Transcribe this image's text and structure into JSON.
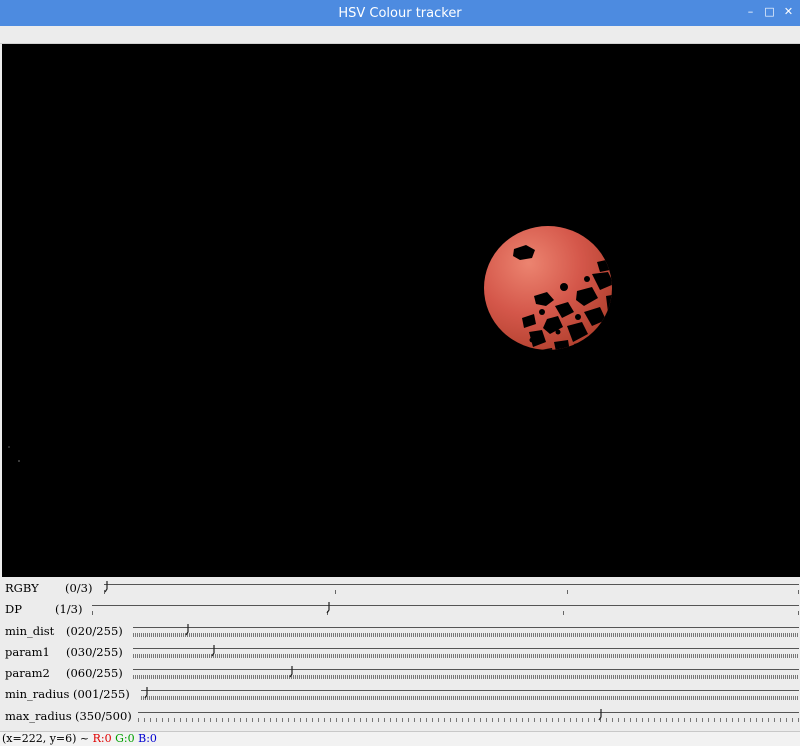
{
  "window": {
    "title": "HSV Colour tracker",
    "controls": [
      "minimize-icon",
      "maximize-icon",
      "close-icon"
    ]
  },
  "trackbars": [
    {
      "label": "RGBY",
      "value_text": "(0/3)",
      "value": 0,
      "max": 3,
      "tick_style": "sparse"
    },
    {
      "label": "DP",
      "value_text": "(1/3)",
      "value": 1,
      "max": 3,
      "tick_style": "sparse"
    },
    {
      "label": "min_dist",
      "value_text": "(020/255)",
      "value": 20,
      "max": 255,
      "tick_style": "dense"
    },
    {
      "label": "param1",
      "value_text": "(030/255)",
      "value": 30,
      "max": 255,
      "tick_style": "dense"
    },
    {
      "label": "param2",
      "value_text": "(060/255)",
      "value": 60,
      "max": 255,
      "tick_style": "dense"
    },
    {
      "label": "min_radius",
      "value_text": "(001/255)",
      "value": 1,
      "max": 255,
      "tick_style": "dense"
    },
    {
      "label": "max_radius",
      "value_text": "(350/500)",
      "value": 350,
      "max": 500,
      "tick_style": "medium"
    }
  ],
  "status": {
    "coords": "(x=222, y=6) ~",
    "r": "R:0",
    "g": "G:0",
    "b": "B:0"
  },
  "colors": {
    "titlebar": "#4d8be0",
    "ball": "#d4574a",
    "ball_highlight": "#ec8470"
  }
}
